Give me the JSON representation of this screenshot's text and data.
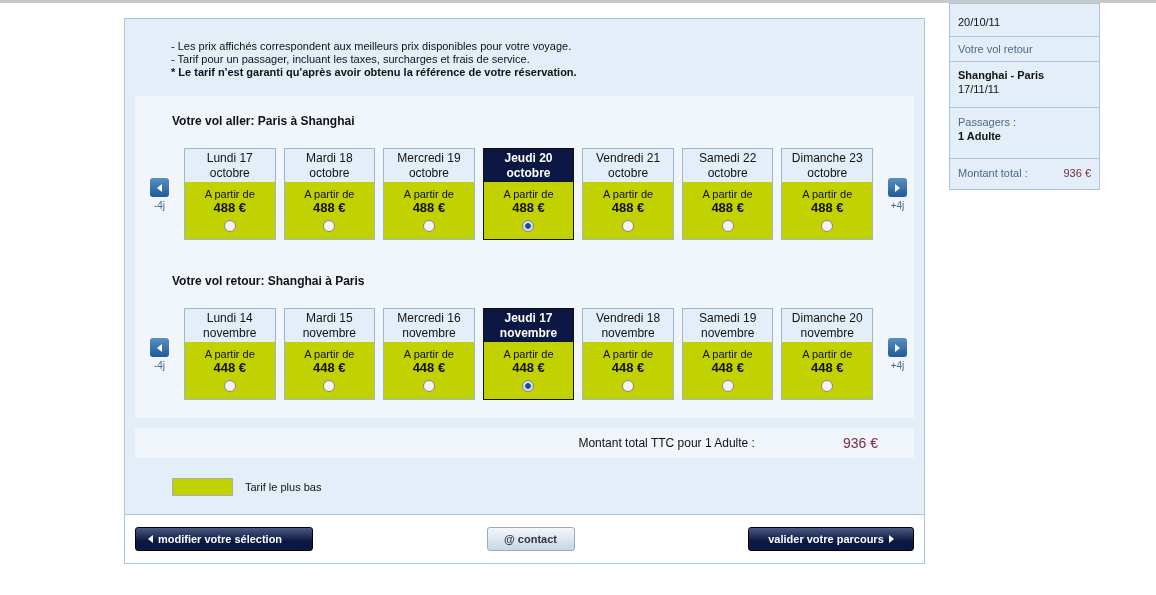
{
  "notes": [
    {
      "text": "- Les prix affichés correspondent aux meilleurs prix disponibles pour votre voyage.",
      "bold": false
    },
    {
      "text": "- Tarif pour un passager, incluant les taxes, surcharges et frais de service.",
      "bold": false
    },
    {
      "text": "* Le tarif n'est garanti qu'après avoir obtenu la référence de votre réservation.",
      "bold": true
    }
  ],
  "flights": [
    {
      "title": "Votre vol aller: Paris à Shanghai",
      "prev_label": "-4j",
      "next_label": "+4j",
      "days": [
        {
          "day": "Lundi 17",
          "month": "octobre",
          "from": "A partir de",
          "price": "488 €",
          "selected": false
        },
        {
          "day": "Mardi 18",
          "month": "octobre",
          "from": "A partir de",
          "price": "488 €",
          "selected": false
        },
        {
          "day": "Mercredi 19",
          "month": "octobre",
          "from": "A partir de",
          "price": "488 €",
          "selected": false
        },
        {
          "day": "Jeudi 20",
          "month": "octobre",
          "from": "A partir de",
          "price": "488 €",
          "selected": true
        },
        {
          "day": "Vendredi 21",
          "month": "octobre",
          "from": "A partir de",
          "price": "488 €",
          "selected": false
        },
        {
          "day": "Samedi 22",
          "month": "octobre",
          "from": "A partir de",
          "price": "488 €",
          "selected": false
        },
        {
          "day": "Dimanche 23",
          "month": "octobre",
          "from": "A partir de",
          "price": "488 €",
          "selected": false
        }
      ]
    },
    {
      "title": "Votre vol retour: Shanghai à Paris",
      "prev_label": "-4j",
      "next_label": "+4j",
      "days": [
        {
          "day": "Lundi 14",
          "month": "novembre",
          "from": "A partir de",
          "price": "448 €",
          "selected": false
        },
        {
          "day": "Mardi 15",
          "month": "novembre",
          "from": "A partir de",
          "price": "448 €",
          "selected": false
        },
        {
          "day": "Mercredi 16",
          "month": "novembre",
          "from": "A partir de",
          "price": "448 €",
          "selected": false
        },
        {
          "day": "Jeudi 17",
          "month": "novembre",
          "from": "A partir de",
          "price": "448 €",
          "selected": true
        },
        {
          "day": "Vendredi 18",
          "month": "novembre",
          "from": "A partir de",
          "price": "448 €",
          "selected": false
        },
        {
          "day": "Samedi 19",
          "month": "novembre",
          "from": "A partir de",
          "price": "448 €",
          "selected": false
        },
        {
          "day": "Dimanche 20",
          "month": "novembre",
          "from": "A partir de",
          "price": "448 €",
          "selected": false
        }
      ]
    }
  ],
  "total": {
    "label": "Montant total TTC pour 1 Adulte :",
    "amount": "936 €"
  },
  "legend": {
    "label": "Tarif le plus bas"
  },
  "buttons": [
    {
      "label": "modifier votre sélection",
      "kind": "back"
    },
    {
      "label": "@ contact",
      "kind": "contact"
    },
    {
      "label": "valider votre parcours",
      "kind": "next"
    }
  ],
  "sidebar": {
    "outbound_date": "20/10/11",
    "return_heading": "Votre vol retour",
    "return_route": "Shanghai - Paris",
    "return_date": "17/11/11",
    "passengers_label": "Passagers :",
    "passengers": "1 Adulte",
    "total_label": "Montant total :",
    "total": "936 €"
  }
}
